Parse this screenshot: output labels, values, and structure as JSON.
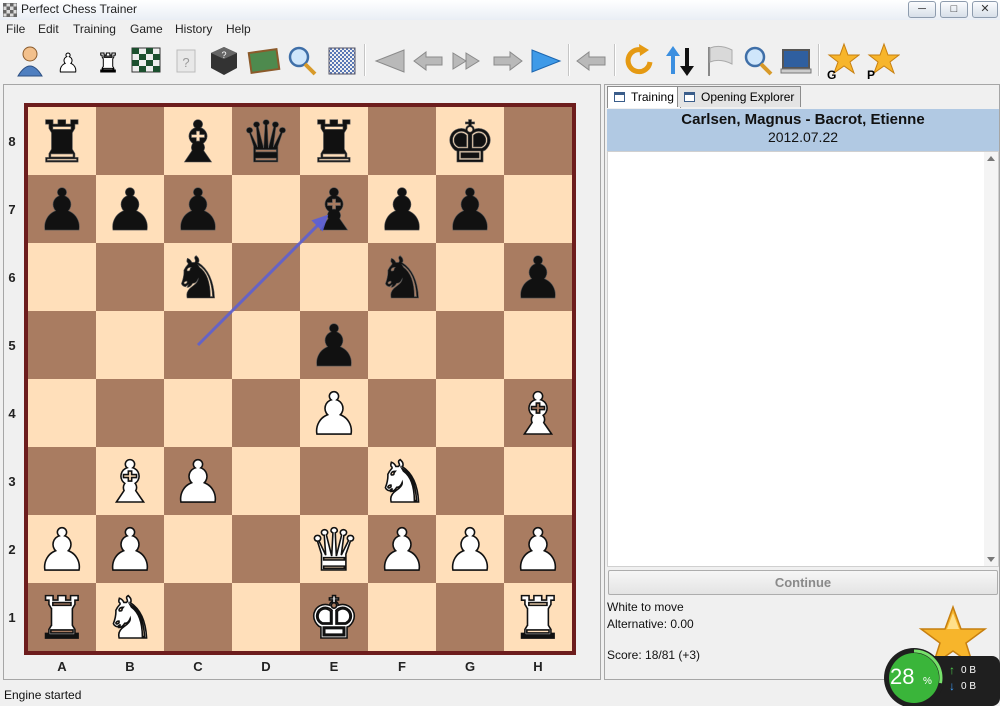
{
  "window": {
    "title": "Perfect Chess Trainer",
    "minimize": "─",
    "maximize": "□",
    "close": "✕"
  },
  "menu": [
    "File",
    "Edit",
    "Training",
    "Game",
    "History",
    "Help"
  ],
  "toolbar": {
    "icons": [
      "user-icon",
      "pawn-icon",
      "rook-icon",
      "board-icon",
      "help-icon",
      "cube-icon",
      "blackboard-icon",
      "search-icon",
      "pattern-icon",
      "first-move-icon",
      "previous-move-icon",
      "fast-forward-icon",
      "next-move-icon",
      "play-icon",
      "back-icon",
      "refresh-icon",
      "sort-icon",
      "flag-icon",
      "zoom-icon",
      "monitor-icon",
      "star-g-icon",
      "star-p-icon"
    ],
    "star_g_label": "G",
    "star_p_label": "P"
  },
  "board": {
    "ranks": [
      "8",
      "7",
      "6",
      "5",
      "4",
      "3",
      "2",
      "1"
    ],
    "files": [
      "A",
      "B",
      "C",
      "D",
      "E",
      "F",
      "G",
      "H"
    ],
    "light_color": "#ffdfba",
    "dark_color": "#a97c61",
    "frame_color": "#6d1d1d",
    "pieces": [
      {
        "square": "a8",
        "glyph": "♜",
        "color": "black"
      },
      {
        "square": "c8",
        "glyph": "♝",
        "color": "black"
      },
      {
        "square": "d8",
        "glyph": "♛",
        "color": "black"
      },
      {
        "square": "e8",
        "glyph": "♜",
        "color": "black"
      },
      {
        "square": "g8",
        "glyph": "♚",
        "color": "black"
      },
      {
        "square": "a7",
        "glyph": "♟",
        "color": "black"
      },
      {
        "square": "b7",
        "glyph": "♟",
        "color": "black"
      },
      {
        "square": "c7",
        "glyph": "♟",
        "color": "black"
      },
      {
        "square": "e7",
        "glyph": "♝",
        "color": "black"
      },
      {
        "square": "f7",
        "glyph": "♟",
        "color": "black"
      },
      {
        "square": "g7",
        "glyph": "♟",
        "color": "black"
      },
      {
        "square": "c6",
        "glyph": "♞",
        "color": "black"
      },
      {
        "square": "f6",
        "glyph": "♞",
        "color": "black"
      },
      {
        "square": "h6",
        "glyph": "♟",
        "color": "black"
      },
      {
        "square": "e5",
        "glyph": "♟",
        "color": "black"
      },
      {
        "square": "e4",
        "glyph": "♟",
        "color": "white"
      },
      {
        "square": "h4",
        "glyph": "♝",
        "color": "white"
      },
      {
        "square": "b3",
        "glyph": "♝",
        "color": "white"
      },
      {
        "square": "c3",
        "glyph": "♟",
        "color": "white"
      },
      {
        "square": "f3",
        "glyph": "♞",
        "color": "white"
      },
      {
        "square": "a2",
        "glyph": "♟",
        "color": "white"
      },
      {
        "square": "b2",
        "glyph": "♟",
        "color": "white"
      },
      {
        "square": "e2",
        "glyph": "♛",
        "color": "white"
      },
      {
        "square": "f2",
        "glyph": "♟",
        "color": "white"
      },
      {
        "square": "g2",
        "glyph": "♟",
        "color": "white"
      },
      {
        "square": "h2",
        "glyph": "♟",
        "color": "white"
      },
      {
        "square": "a1",
        "glyph": "♜",
        "color": "white"
      },
      {
        "square": "b1",
        "glyph": "♞",
        "color": "white"
      },
      {
        "square": "e1",
        "glyph": "♚",
        "color": "white"
      },
      {
        "square": "h1",
        "glyph": "♜",
        "color": "white"
      }
    ],
    "arrow": {
      "from": "c5",
      "to": "e7",
      "color": "#5a5fd8"
    }
  },
  "tabs": [
    {
      "label": "Training",
      "active": true
    },
    {
      "label": "Opening Explorer",
      "active": false
    }
  ],
  "game": {
    "players": "Carlsen, Magnus - Bacrot, Etienne",
    "date": "2012.07.22",
    "header_color": "#b1c9e3"
  },
  "continue_label": "Continue",
  "info": {
    "to_move": "White to move",
    "alternative": "Alternative: 0.00",
    "score": "Score: 18/81 (+3)"
  },
  "status": "Engine started",
  "net": {
    "percent": "28",
    "percent_sign": "%",
    "upload": "0 B",
    "download": "0 B",
    "progress": 0.28
  }
}
